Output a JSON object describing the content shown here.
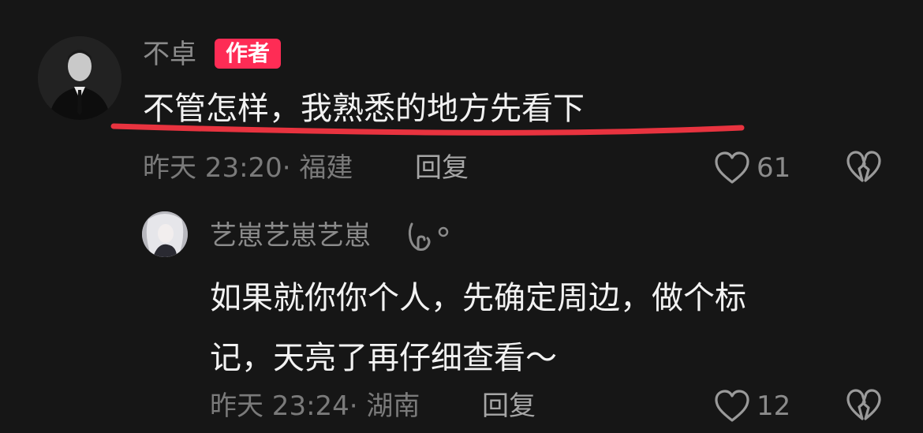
{
  "comment": {
    "username": "不卓",
    "author_badge": "作者",
    "text": "不管怎样，我熟悉的地方先看下",
    "time": "昨天 23:20",
    "location": "福建",
    "reply_label": "回复",
    "like_count": "61",
    "underline_color": "#e8333f"
  },
  "reply": {
    "username": "艺崽艺崽艺崽",
    "text_line1": "如果就你你个人，先确定周边，做个标",
    "text_line2": "记，天亮了再仔细查看～",
    "time": "昨天 23:24",
    "location": "湖南",
    "reply_label": "回复",
    "like_count": "12"
  },
  "icons": {
    "like": "heart-outline-icon",
    "dislike": "broken-heart-icon",
    "liked_by_author": "heart-hand-icon"
  },
  "colors": {
    "background": "#161616",
    "badge": "#fe2c55"
  }
}
